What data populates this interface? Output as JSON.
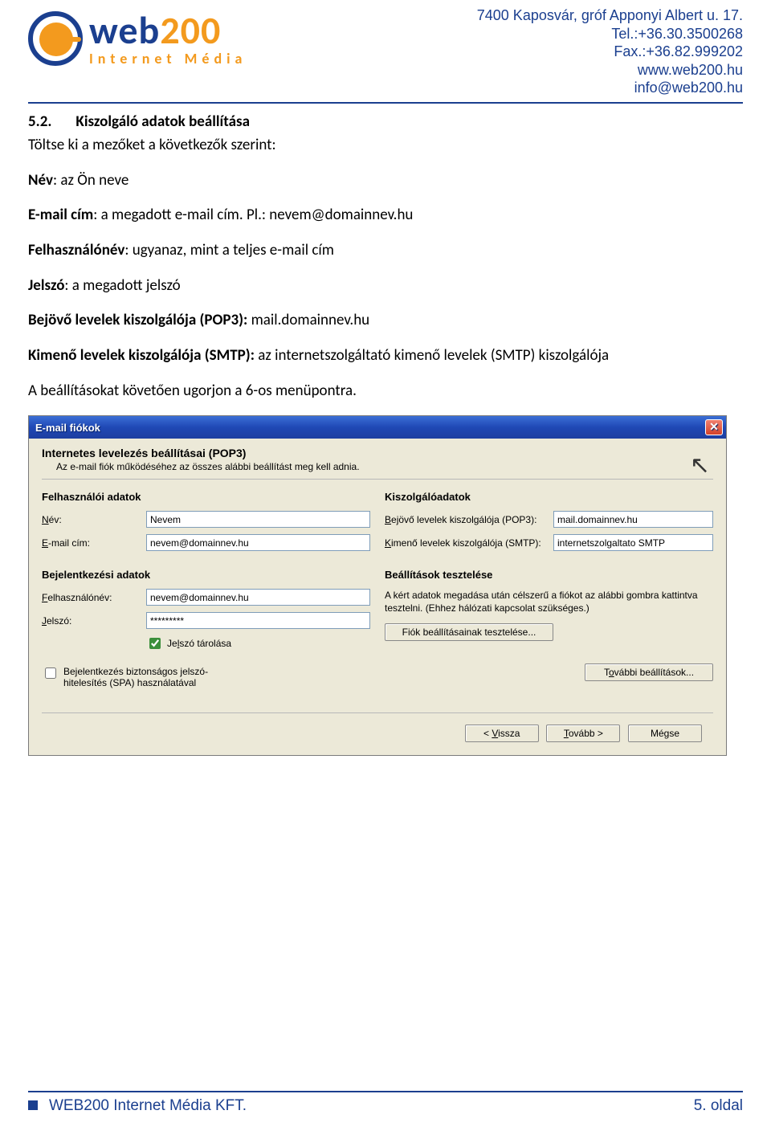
{
  "header": {
    "brand_web": "web",
    "brand_200": "200",
    "brand_sub": "Internet Média",
    "addr": "7400 Kaposvár, gróf Apponyi Albert u. 17.",
    "tel": "Tel.:+36.30.3500268",
    "fax": "Fax.:+36.82.999202",
    "www": "www.web200.hu",
    "email": "info@web200.hu"
  },
  "doc": {
    "sec_num": "5.2.",
    "sec_title": "Kiszolgáló adatok beállítása",
    "p1": "Töltse ki a mezőket a következők szerint:",
    "name_lbl": "Név",
    "name_txt": ": az Ön neve",
    "email_lbl": "E-mail cím",
    "email_txt": ": a megadott e-mail cím. Pl.: nevem@domainnev.hu",
    "user_lbl": "Felhasználónév",
    "user_txt": ": ugyanaz, mint a teljes e-mail cím",
    "pwd_lbl": "Jelszó",
    "pwd_txt": ": a megadott jelszó",
    "pop_lbl": "Bejövő levelek kiszolgálója (POP3): ",
    "pop_txt": "mail.domainnev.hu",
    "smtp_lbl": "Kimenő levelek kiszolgálója (SMTP): ",
    "smtp_txt": "az internetszolgáltató kimenő levelek (SMTP) kiszolgálója",
    "after": "A beállításokat követően ugorjon a 6-os menüpontra."
  },
  "dialog": {
    "title": "E-mail fiókok",
    "heading": "Internetes levelezés beállításai (POP3)",
    "sub": "Az e-mail fiók működéséhez az összes alábbi beállítást meg kell adnia.",
    "user_group": "Felhasználói adatok",
    "server_group": "Kiszolgálóadatok",
    "login_group": "Bejelentkezési adatok",
    "test_group": "Beállítások tesztelése",
    "lbl_name": "Név:",
    "val_name": "Nevem",
    "lbl_email": "E-mail cím:",
    "val_email": "nevem@domainnev.hu",
    "lbl_pop": "Bejövő levelek kiszolgálója (POP3):",
    "val_pop": "mail.domainnev.hu",
    "lbl_smtp": "Kimenő levelek kiszolgálója (SMTP):",
    "val_smtp": "internetszolgaltato SMTP",
    "lbl_user": "Felhasználónév:",
    "val_user": "nevem@domainnev.hu",
    "lbl_pwd": "Jelszó:",
    "val_pwd": "*********",
    "chk_save": "Jelszó tárolása",
    "chk_spa": "Bejelentkezés biztonságos jelszó-hitelesítés (SPA) használatával",
    "test_desc": "A kért adatok megadása után célszerű a fiókot az alábbi gombra kattintva tesztelni. (Ehhez hálózati kapcsolat szükséges.)",
    "btn_test": "Fiók beállításainak tesztelése...",
    "btn_more": "További beállítások...",
    "btn_back": "< Vissza",
    "btn_next": "Tovább >",
    "btn_cancel": "Mégse"
  },
  "footer": {
    "company": "WEB200 Internet Média KFT.",
    "page": "5. oldal"
  }
}
